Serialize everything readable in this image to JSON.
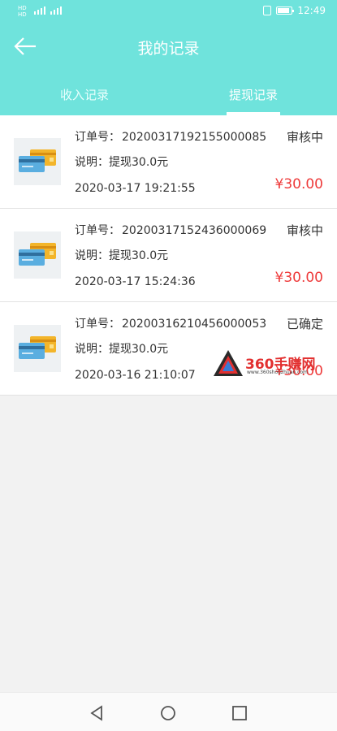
{
  "status_bar": {
    "carrier_lines": [
      "HD",
      "HD"
    ],
    "network": "4G",
    "time": "12:49",
    "battery_level": 0.85
  },
  "header": {
    "title": "我的记录",
    "tabs": [
      {
        "label": "收入记录",
        "active": false
      },
      {
        "label": "提现记录",
        "active": true
      }
    ]
  },
  "records": [
    {
      "order_label": "订单号：",
      "order_number": "20200317192155000085",
      "description": "说明：提现30.0元",
      "time": "2020-03-17 19:21:55",
      "status": "审核中",
      "amount": "¥30.00"
    },
    {
      "order_label": "订单号：",
      "order_number": "20200317152436000069",
      "description": "说明：提现30.0元",
      "time": "2020-03-17 15:24:36",
      "status": "审核中",
      "amount": "¥30.00"
    },
    {
      "order_label": "订单号：",
      "order_number": "20200316210456000053",
      "description": "说明：提现30.0元",
      "time": "2020-03-16 21:10:07",
      "status": "已确定",
      "amount": "¥30.00"
    }
  ],
  "watermark": {
    "text": "360手赚网",
    "url": "www.360shouzhuan.com"
  },
  "colors": {
    "header_bg": "#6fe3dc",
    "amount": "#ee3b3b",
    "page_bg": "#f2f2f2"
  }
}
